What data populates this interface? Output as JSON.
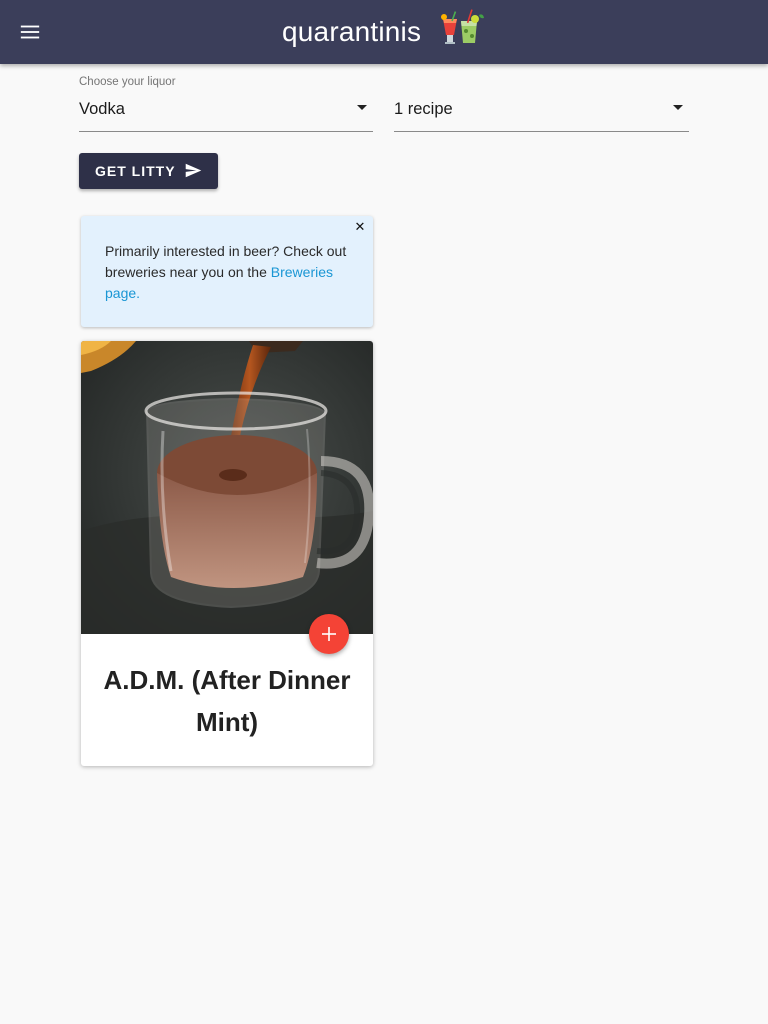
{
  "appbar": {
    "title": "quarantinis",
    "menu_icon": "hamburger-menu-icon",
    "logo_icon": "cocktail-glasses-icon",
    "background_color": "#3b3e5a"
  },
  "filters": {
    "liquor_label": "Choose your liquor",
    "liquor_value": "Vodka",
    "count_value": "1 recipe"
  },
  "action_button": {
    "label": "GET LITTY",
    "icon": "send-icon",
    "color": "#2e3048"
  },
  "info_banner": {
    "text": "Primarily interested in beer? Check out breweries near you on the ",
    "link_text": "Breweries page.",
    "close_icon": "close-icon",
    "background_color": "#e3f1fd",
    "link_color": "#1a96d4"
  },
  "recipes": [
    {
      "title": "A.D.M. (After Dinner Mint)",
      "image": "hot-chocolate-mug-photo",
      "add_icon": "plus-icon",
      "fab_color": "#f44336"
    }
  ]
}
